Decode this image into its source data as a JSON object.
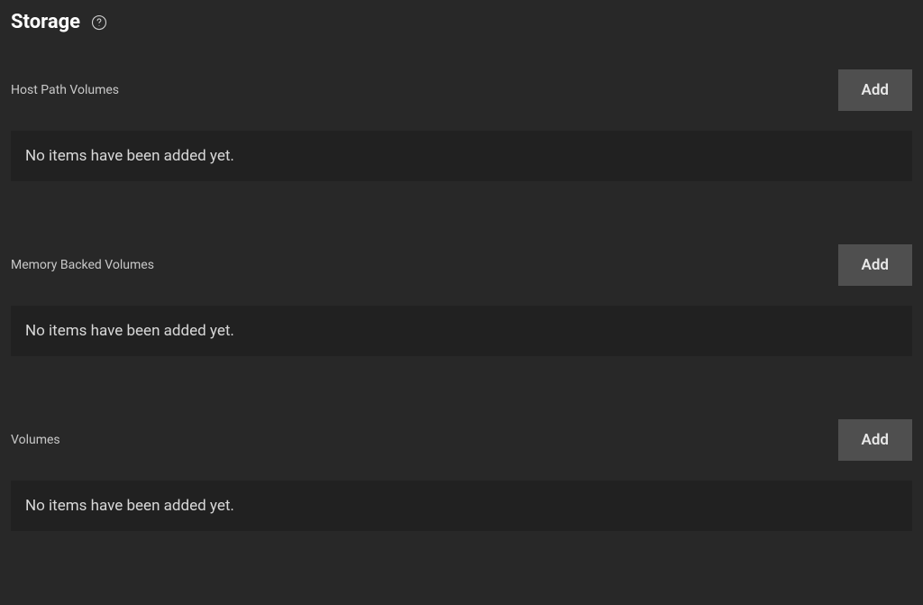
{
  "page": {
    "title": "Storage"
  },
  "sections": [
    {
      "label": "Host Path Volumes",
      "add_button_label": "Add",
      "empty_message": "No items have been added yet."
    },
    {
      "label": "Memory Backed Volumes",
      "add_button_label": "Add",
      "empty_message": "No items have been added yet."
    },
    {
      "label": "Volumes",
      "add_button_label": "Add",
      "empty_message": "No items have been added yet."
    }
  ]
}
